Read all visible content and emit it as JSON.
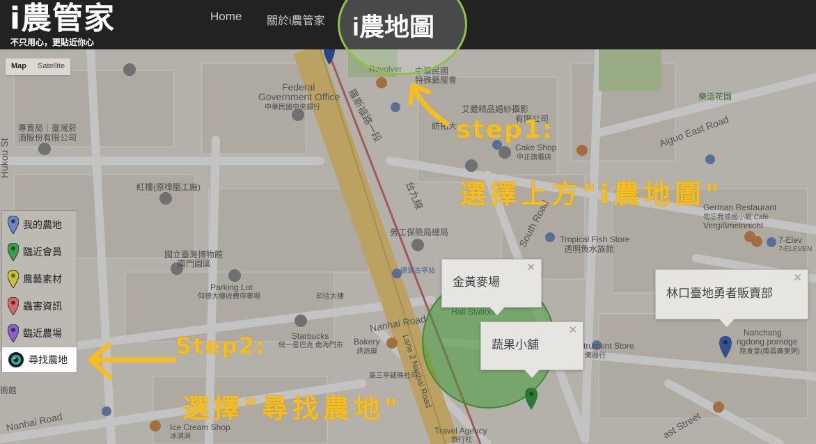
{
  "header": {
    "brand": "i農管家",
    "slogan": "不只用心，更貼近你心",
    "nav": {
      "home": "Home",
      "about": "關於i農管家",
      "farm_map": "i農地圖"
    }
  },
  "map": {
    "type_control": {
      "map": "Map",
      "satellite": "Satellite"
    },
    "labels": {
      "revolver": "Revolver",
      "republic_expo": "中華民國",
      "republic_expo2": "特殊藝展會",
      "federal1": "Federal",
      "federal2": "Government Office",
      "federal3": "中華民國中央銀行",
      "tobacco1": "專賣局｜臺灣菸",
      "tobacco2": "酒股份有限公司",
      "luosifu": "羅斯福路一段",
      "taijiu": "台九線",
      "fangtuo": "紡拓大",
      "aitang": "艾葳精品婚紗攝影",
      "aitang2": "有限公司",
      "cakeshop1": "Cake Shop",
      "cakeshop2": "中正旗艦店",
      "aiguo": "Aiguo East Road",
      "leshi": "樂活花園",
      "hongyuan": "紅樓(原樟腦工廠)",
      "german1": "German Restaurant",
      "german2": "勿忘我德國小館 Café",
      "german3": "Vergißmeinnicht",
      "labor": "勞工保險局總局",
      "museum1": "國立臺灣博物館",
      "museum2": "南門園區",
      "tropical1": "Tropical Fish Store",
      "tropical2": "透明魚水族館",
      "seven1": "7-Elev",
      "seven2": "7-ELEVEN",
      "parking1": "Parking Lot",
      "parking2": "仰德大樓收費停車場",
      "jieyun": "捷運古亭站",
      "lixiang": "印信大樓",
      "nanhai1": "Nanhai Road",
      "starbucks1": "Starbucks",
      "starbucks2": "統一星巴克 南海門市",
      "bakery1": "Bakery",
      "bakery2": "烘焙屋",
      "nanchang1": "Nanchang",
      "nanchang2": "ngdong porridge",
      "nanchang3": "路食堂(南昌廣東粥)",
      "instrument1": "trument Store",
      "instrument2": "樂器行",
      "gaosan": "高三亭錶殊社司",
      "nanhai2": "Nanhai Road",
      "icecream1": "Ice Cream Shop",
      "icecream2": "冰淇淋",
      "travel1": "Travel Agency",
      "travel2": "旅行社",
      "lane": "Lane 2 Nanhai Road",
      "hall": "Hall Station",
      "east_street": "ast Street",
      "museum_south": "術館",
      "road_south": "South Road",
      "kulou": "Hukou St"
    },
    "infowindows": {
      "golden": "金黃麥場",
      "veggie": "蔬果小舖",
      "linkou": "林口臺地勇者販賣部"
    }
  },
  "legend": {
    "items": [
      {
        "label": "我的農地",
        "color": "#6d86c6"
      },
      {
        "label": "臨近會員",
        "color": "#3aa04a"
      },
      {
        "label": "農藝素材",
        "color": "#c8c23a"
      },
      {
        "label": "蟲害資訊",
        "color": "#d36b6b"
      },
      {
        "label": "臨近農場",
        "color": "#8a62c8"
      }
    ],
    "find_farm": "尋找農地"
  },
  "annotations": {
    "step1_label": "step1:",
    "step1_text": "選擇上方\"i農地圖\"",
    "step2_label": "Step2:",
    "step2_text": "選擇\"尋找農地\"",
    "color": "#f5be1e"
  }
}
